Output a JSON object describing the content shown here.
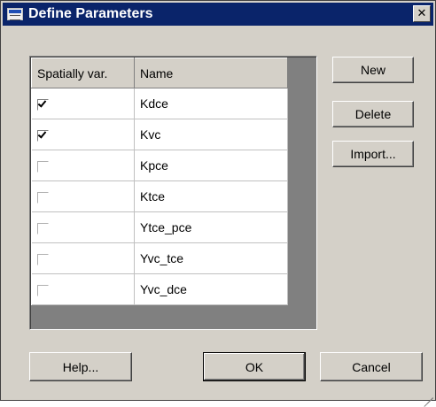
{
  "window": {
    "title": "Define Parameters",
    "close_glyph": "✕"
  },
  "table": {
    "headers": [
      "Spatially var.",
      "Name"
    ],
    "rows": [
      {
        "checked": true,
        "enabled": true,
        "name": "Kdce"
      },
      {
        "checked": true,
        "enabled": true,
        "name": "Kvc"
      },
      {
        "checked": false,
        "enabled": false,
        "name": "Kpce"
      },
      {
        "checked": false,
        "enabled": false,
        "name": "Ktce"
      },
      {
        "checked": false,
        "enabled": false,
        "name": "Ytce_pce"
      },
      {
        "checked": false,
        "enabled": false,
        "name": "Yvc_tce"
      },
      {
        "checked": false,
        "enabled": false,
        "name": "Yvc_dce"
      }
    ]
  },
  "side_buttons": {
    "new": "New",
    "delete": "Delete",
    "import": "Import..."
  },
  "bottom_buttons": {
    "help": "Help...",
    "ok": "OK",
    "cancel": "Cancel"
  },
  "colors": {
    "titlebar": "#0a246a",
    "face": "#d4d0c8",
    "grid_bg": "#808080"
  }
}
